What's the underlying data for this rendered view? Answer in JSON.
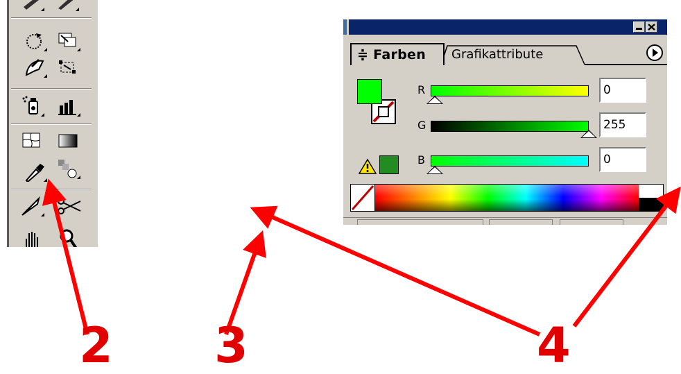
{
  "palette": {
    "tabs": [
      {
        "label": "Farben",
        "glyph": "≑",
        "active": true
      },
      {
        "label": "Grafikattribute",
        "active": false
      }
    ],
    "title_buttons": [
      "minimize-icon",
      "close-icon"
    ],
    "menu_button": "menu-arrow-icon",
    "fill_color": "#00ff00",
    "stroke": "none",
    "channels": [
      {
        "label": "R",
        "value": "0",
        "slider": "red-ramp",
        "level": 0.0
      },
      {
        "label": "G",
        "value": "255",
        "slider": "green-ramp",
        "level": 1.0
      },
      {
        "label": "B",
        "value": "0",
        "slider": "blue-ramp",
        "level": 0.0
      }
    ],
    "out_of_gamut_icon": "warning-icon",
    "web_safe_color": "#228b22"
  },
  "toolbox": {
    "tools": [
      "pen-icon",
      "pencil-icon",
      "rotate-icon",
      "scale-icon",
      "reshape-icon",
      "free-transform-icon",
      "symbol-sprayer-icon",
      "graph-icon",
      "mesh-icon",
      "gradient-icon",
      "eyedropper-icon",
      "blend-icon",
      "knife-icon",
      "scissors-icon",
      "hand-icon",
      "zoom-icon"
    ]
  },
  "annotations": {
    "labels": [
      "2",
      "3",
      "4"
    ],
    "color": "#ff0000"
  }
}
